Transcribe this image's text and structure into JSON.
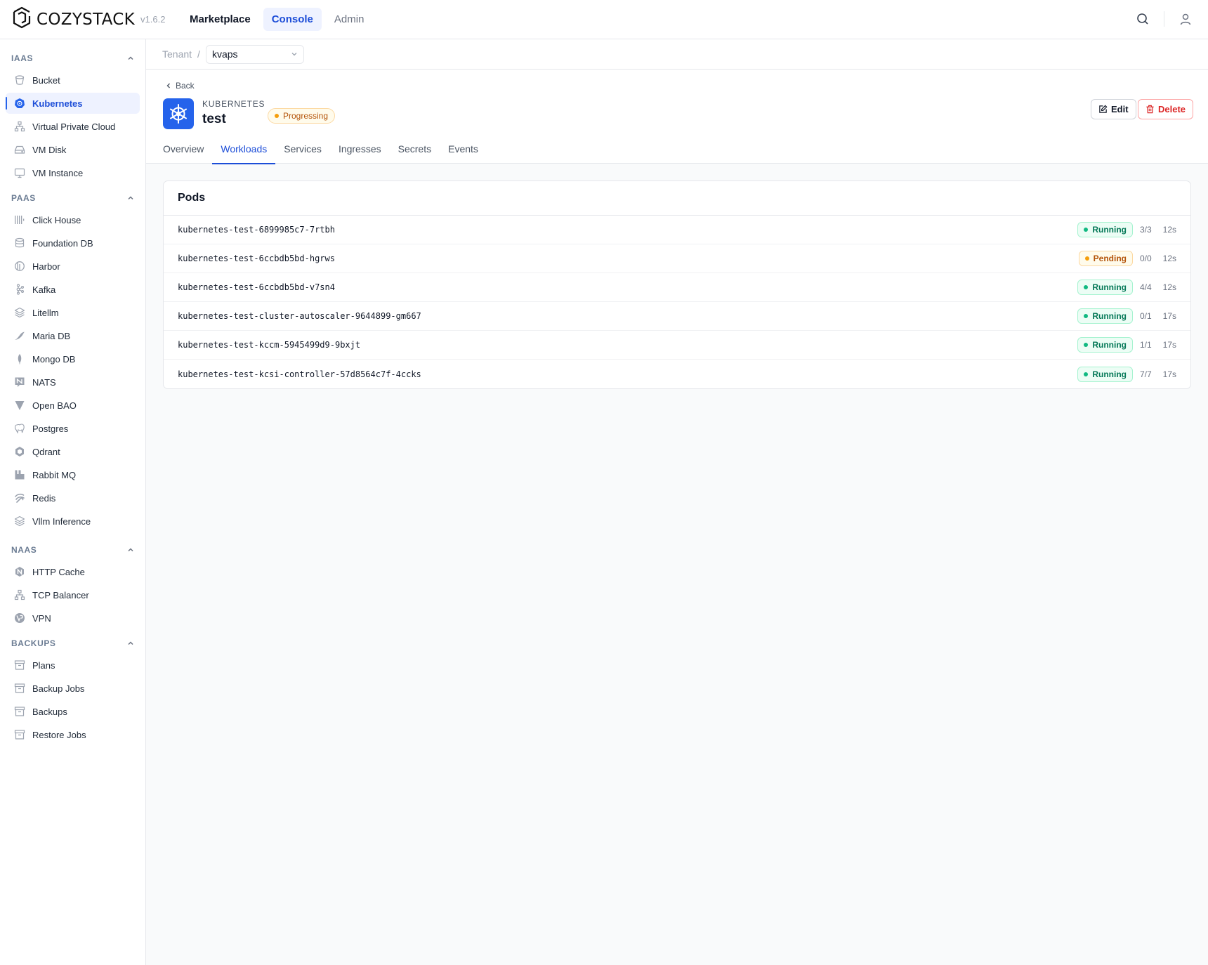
{
  "app": {
    "brand": "COZYSTACK",
    "version": "v1.6.2",
    "nav": [
      "Marketplace",
      "Console",
      "Admin"
    ]
  },
  "sidebar": {
    "sections": [
      {
        "title": "IAAS",
        "items": [
          "Bucket",
          "Kubernetes",
          "Virtual Private Cloud",
          "VM Disk",
          "VM Instance"
        ]
      },
      {
        "title": "PAAS",
        "items": [
          "Click House",
          "Foundation DB",
          "Harbor",
          "Kafka",
          "Litellm",
          "Maria DB",
          "Mongo DB",
          "NATS",
          "Open BAO",
          "Postgres",
          "Qdrant",
          "Rabbit MQ",
          "Redis",
          "Vllm Inference"
        ]
      },
      {
        "title": "NAAS",
        "items": [
          "HTTP Cache",
          "TCP Balancer",
          "VPN"
        ]
      },
      {
        "title": "BACKUPS",
        "items": [
          "Plans",
          "Backup Jobs",
          "Backups",
          "Restore Jobs"
        ]
      }
    ],
    "active": "Kubernetes"
  },
  "breadcrumb": {
    "root": "Tenant",
    "separator": "/",
    "tenant": "kvaps"
  },
  "resource": {
    "back_label": "Back",
    "kind": "KUBERNETES",
    "name": "test",
    "status": "Progressing",
    "edit_label": "Edit",
    "delete_label": "Delete"
  },
  "tabs": [
    "Overview",
    "Workloads",
    "Services",
    "Ingresses",
    "Secrets",
    "Events"
  ],
  "active_tab": "Workloads",
  "pods": {
    "title": "Pods",
    "rows": [
      {
        "name": "kubernetes-test-6899985c7-7rtbh",
        "status": "Running",
        "ready": "3/3",
        "age": "12s"
      },
      {
        "name": "kubernetes-test-6ccbdb5bd-hgrws",
        "status": "Pending",
        "ready": "0/0",
        "age": "12s"
      },
      {
        "name": "kubernetes-test-6ccbdb5bd-v7sn4",
        "status": "Running",
        "ready": "4/4",
        "age": "12s"
      },
      {
        "name": "kubernetes-test-cluster-autoscaler-9644899-gm667",
        "status": "Running",
        "ready": "0/1",
        "age": "17s"
      },
      {
        "name": "kubernetes-test-kccm-5945499d9-9bxjt",
        "status": "Running",
        "ready": "1/1",
        "age": "17s"
      },
      {
        "name": "kubernetes-test-kcsi-controller-57d8564c7f-4ccks",
        "status": "Running",
        "ready": "7/7",
        "age": "17s"
      }
    ]
  },
  "colors": {
    "accent": "#1d4ed8",
    "running": "#047857",
    "pending": "#b45309",
    "danger": "#dc2626"
  }
}
